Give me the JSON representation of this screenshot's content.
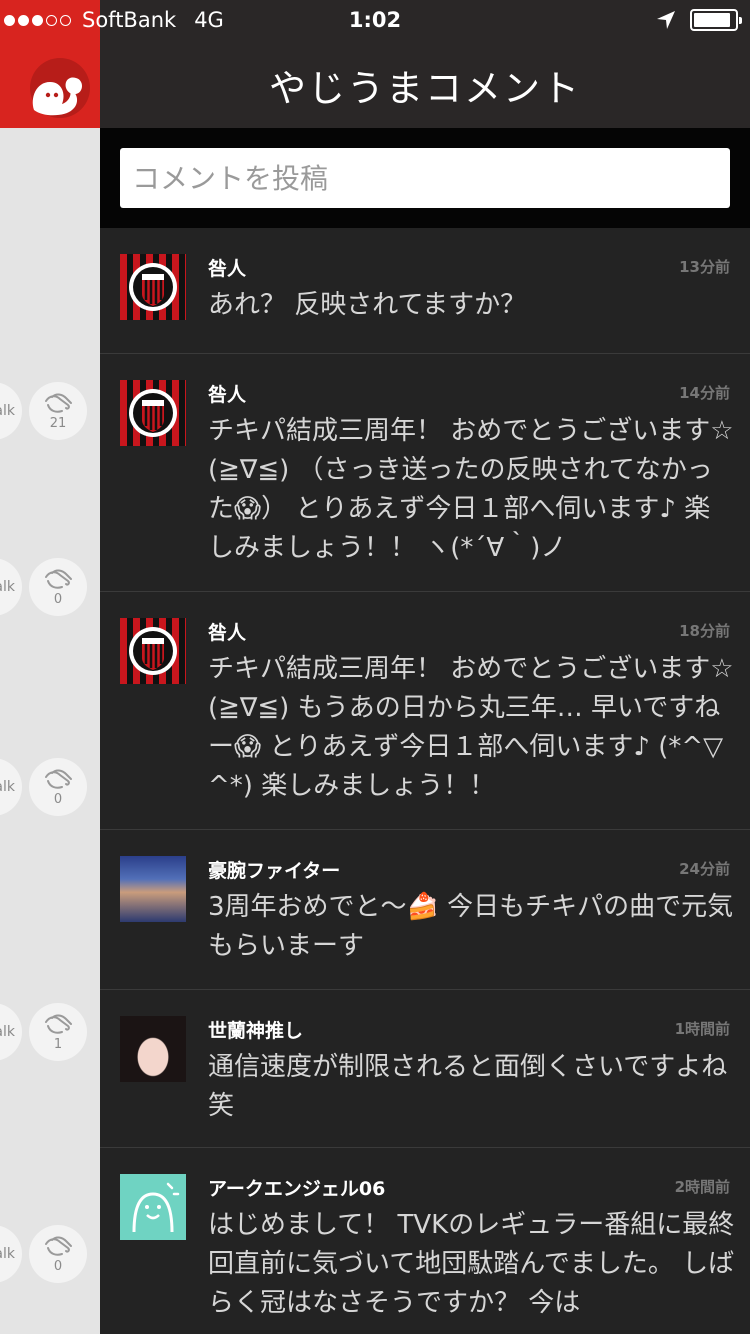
{
  "status_bar": {
    "signal_dots": [
      true,
      true,
      true,
      false,
      false
    ],
    "carrier": "SoftBank",
    "network": "4G",
    "time": "1:02",
    "battery_level": 0.9
  },
  "sidebar": {
    "logo_icon": "yajiuma-ghost-logo",
    "brand_color": "#d8241f",
    "rows": [
      {
        "talk_label": "alk",
        "clap_count": "21"
      },
      {
        "talk_label": "alk",
        "clap_count": "0"
      },
      {
        "talk_label": "alk",
        "clap_count": "0"
      },
      {
        "talk_label": "alk",
        "clap_count": "1"
      },
      {
        "talk_label": "alk",
        "clap_count": "0"
      }
    ]
  },
  "header": {
    "title": "やじうまコメント"
  },
  "compose": {
    "placeholder": "コメントを投稿"
  },
  "comments": [
    {
      "username": "咎人",
      "time": "13分前",
      "avatar": "acmilan-crest",
      "text": "あれ？ 反映されてますか？"
    },
    {
      "username": "咎人",
      "time": "14分前",
      "avatar": "acmilan-crest",
      "text": "チキパ結成三周年！ おめでとうございます☆ (≧∇≦) （さっき送ったの反映されてなかった😱） とりあえず今日１部へ伺います♪ 楽しみましょう！！ ヽ(*´∀｀)ノ"
    },
    {
      "username": "咎人",
      "time": "18分前",
      "avatar": "acmilan-crest",
      "text": "チキパ結成三周年！ おめでとうございます☆ (≧∇≦) もうあの日から丸三年… 早いですねー😱 とりあえず今日１部へ伺います♪ (*^▽^*) 楽しみましょう！！"
    },
    {
      "username": "豪腕ファイター",
      "time": "24分前",
      "avatar": "boxer-photo",
      "text": "3周年おめでと〜🍰 今日もチキパの曲で元気もらいまーす"
    },
    {
      "username": "世蘭神推し",
      "time": "1時間前",
      "avatar": "girl-photo",
      "text": "通信速度が制限されると面倒くさいですよね笑"
    },
    {
      "username": "アークエンジェル06",
      "time": "2時間前",
      "avatar": "default-ghost",
      "text": "はじめまして！ TVKのレギュラー番組に最終回直前に気づいて地団駄踏んでました。 しばらく冠はなさそうですか？ 今は"
    }
  ]
}
